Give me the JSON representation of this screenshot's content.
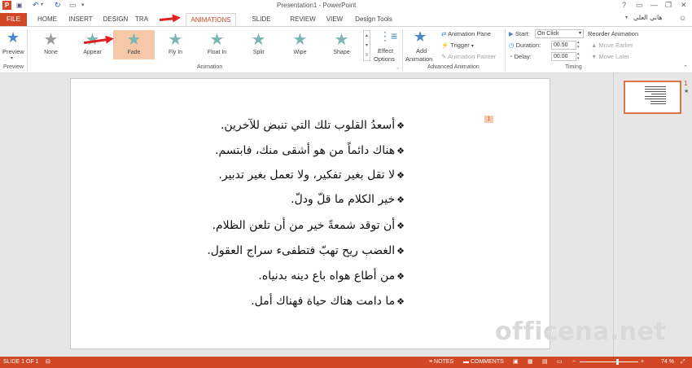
{
  "window": {
    "title": "Presentation1 - PowerPoint",
    "user_name": "هاني العلي",
    "help": "?",
    "minimize": "—",
    "restore": "❐",
    "close": "✕"
  },
  "quick_access": {
    "app_icon": "P",
    "save_icon": "💾",
    "undo_icon": "↶",
    "redo_icon": "↻",
    "start_icon": "▭",
    "customize_icon": "▾"
  },
  "tabs": [
    {
      "label": "FILE",
      "name": "tab-file"
    },
    {
      "label": "HOME",
      "name": "tab-home"
    },
    {
      "label": "INSERT",
      "name": "tab-insert"
    },
    {
      "label": "DESIGN",
      "name": "tab-design"
    },
    {
      "label": "TRANSITIONS",
      "name": "tab-transitions"
    },
    {
      "label": "ANIMATIONS",
      "name": "tab-animations"
    },
    {
      "label": "SLIDE SHOW",
      "name": "tab-slide-show"
    },
    {
      "label": "REVIEW",
      "name": "tab-review"
    },
    {
      "label": "VIEW",
      "name": "tab-view"
    },
    {
      "label": "Design Tools",
      "name": "tab-design-tools"
    }
  ],
  "tabs_visible_transitions": "TRA",
  "ribbon": {
    "preview": {
      "label": "Preview",
      "group_label": "Preview"
    },
    "animation_gallery": [
      {
        "label": "None"
      },
      {
        "label": "Appear"
      },
      {
        "label": "Fade"
      },
      {
        "label": "Fly In"
      },
      {
        "label": "Float In"
      },
      {
        "label": "Split"
      },
      {
        "label": "Wipe"
      },
      {
        "label": "Shape"
      }
    ],
    "effect_options": {
      "line1": "Effect",
      "line2": "Options"
    },
    "animation_group_label": "Animation",
    "add_animation": {
      "line1": "Add",
      "line2": "Animation"
    },
    "animation_pane": "Animation Pane",
    "trigger": "Trigger",
    "animation_painter": "Animation Painter",
    "advanced_group_label": "Advanced Animation",
    "timing": {
      "start_label": "Start:",
      "start_value": "On Click",
      "duration_label": "Duration:",
      "duration_value": "00.50",
      "delay_label": "Delay:",
      "delay_value": "00.00",
      "reorder_label": "Reorder Animation",
      "move_earlier": "Move Earlier",
      "move_later": "Move Later",
      "group_label": "Timing"
    }
  },
  "slide": {
    "animation_tag": "1",
    "bullet_symbol": "❖",
    "lines": [
      "أسعدُ القلوب تلك التي تنبض للآخرين.",
      "هناك دائماً من هو أشقى منك، فابتسم.",
      "لا تقل بغير تفكير، ولا تعمل بغير تدبير.",
      "خير الكلام ما قلّ ودلّ.",
      "أن توقد شمعةً خير من أن تلعن الظلام.",
      "الغضب ريح تهبّ فتطفىء سراج العقول.",
      "من أطاع هواه باع دينه بدنياه.",
      "ما دامت هناك حياة فهناك أمل."
    ]
  },
  "thumbnail": {
    "number": "1",
    "star": "★"
  },
  "watermark": "officena.net",
  "status": {
    "slide_info": "SLIDE 1 OF 1",
    "notes": "NOTES",
    "comments": "COMMENTS",
    "zoom": "74 %"
  },
  "colors": {
    "accent": "#d24726",
    "selected_gallery": "#f6c7a9",
    "arrow": "#e02020"
  }
}
